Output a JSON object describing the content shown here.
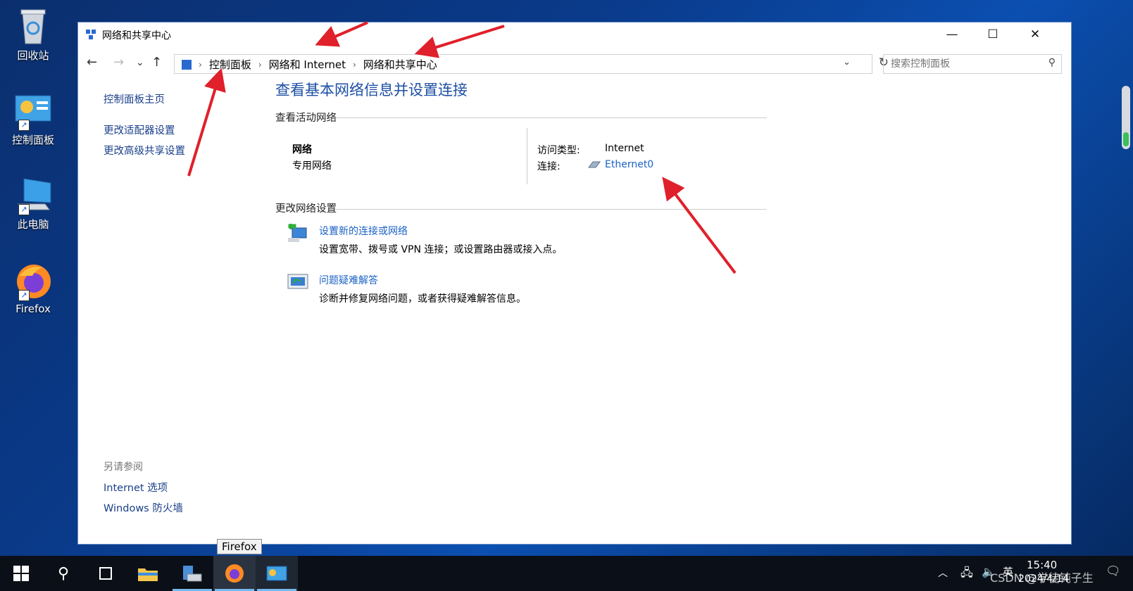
{
  "desktop": {
    "icons": [
      {
        "label": "回收站"
      },
      {
        "label": "控制面板"
      },
      {
        "label": "此电脑"
      },
      {
        "label": "Firefox"
      }
    ]
  },
  "window": {
    "title": "网络和共享中心",
    "controls": {
      "minimize": "—",
      "maximize": "☐",
      "close": "✕"
    }
  },
  "navbar": {
    "back": "←",
    "forward": "→",
    "recent": "⌄",
    "up": "↑",
    "breadcrumb": [
      "控制面板",
      "网络和 Internet",
      "网络和共享中心"
    ],
    "search_placeholder": "搜索控制面板"
  },
  "sidebar": {
    "links": [
      "控制面板主页",
      "更改适配器设置",
      "更改高级共享设置"
    ],
    "see_also_title": "另请参阅",
    "see_also": [
      "Internet 选项",
      "Windows 防火墙"
    ]
  },
  "main": {
    "title": "查看基本网络信息并设置连接",
    "active_networks_header": "查看活动网络",
    "network_name": "网络",
    "network_type": "专用网络",
    "access_type_label": "访问类型:",
    "access_type_value": "Internet",
    "connection_label": "连接:",
    "connection_value": "Ethernet0",
    "change_settings_header": "更改网络设置",
    "tasks": [
      {
        "title": "设置新的连接或网络",
        "desc": "设置宽带、拨号或 VPN 连接；或设置路由器或接入点。"
      },
      {
        "title": "问题疑难解答",
        "desc": "诊断并修复网络问题，或者获得疑难解答信息。"
      }
    ]
  },
  "taskbar": {
    "tooltip": "Firefox",
    "time": "15:40",
    "date": "2024/4/14",
    "ime": "英",
    "watermark": "CSDN @学徒钝子生"
  },
  "colors": {
    "arrow": "#e0202a",
    "link": "#1b62c6",
    "title": "#1d4fa3"
  }
}
